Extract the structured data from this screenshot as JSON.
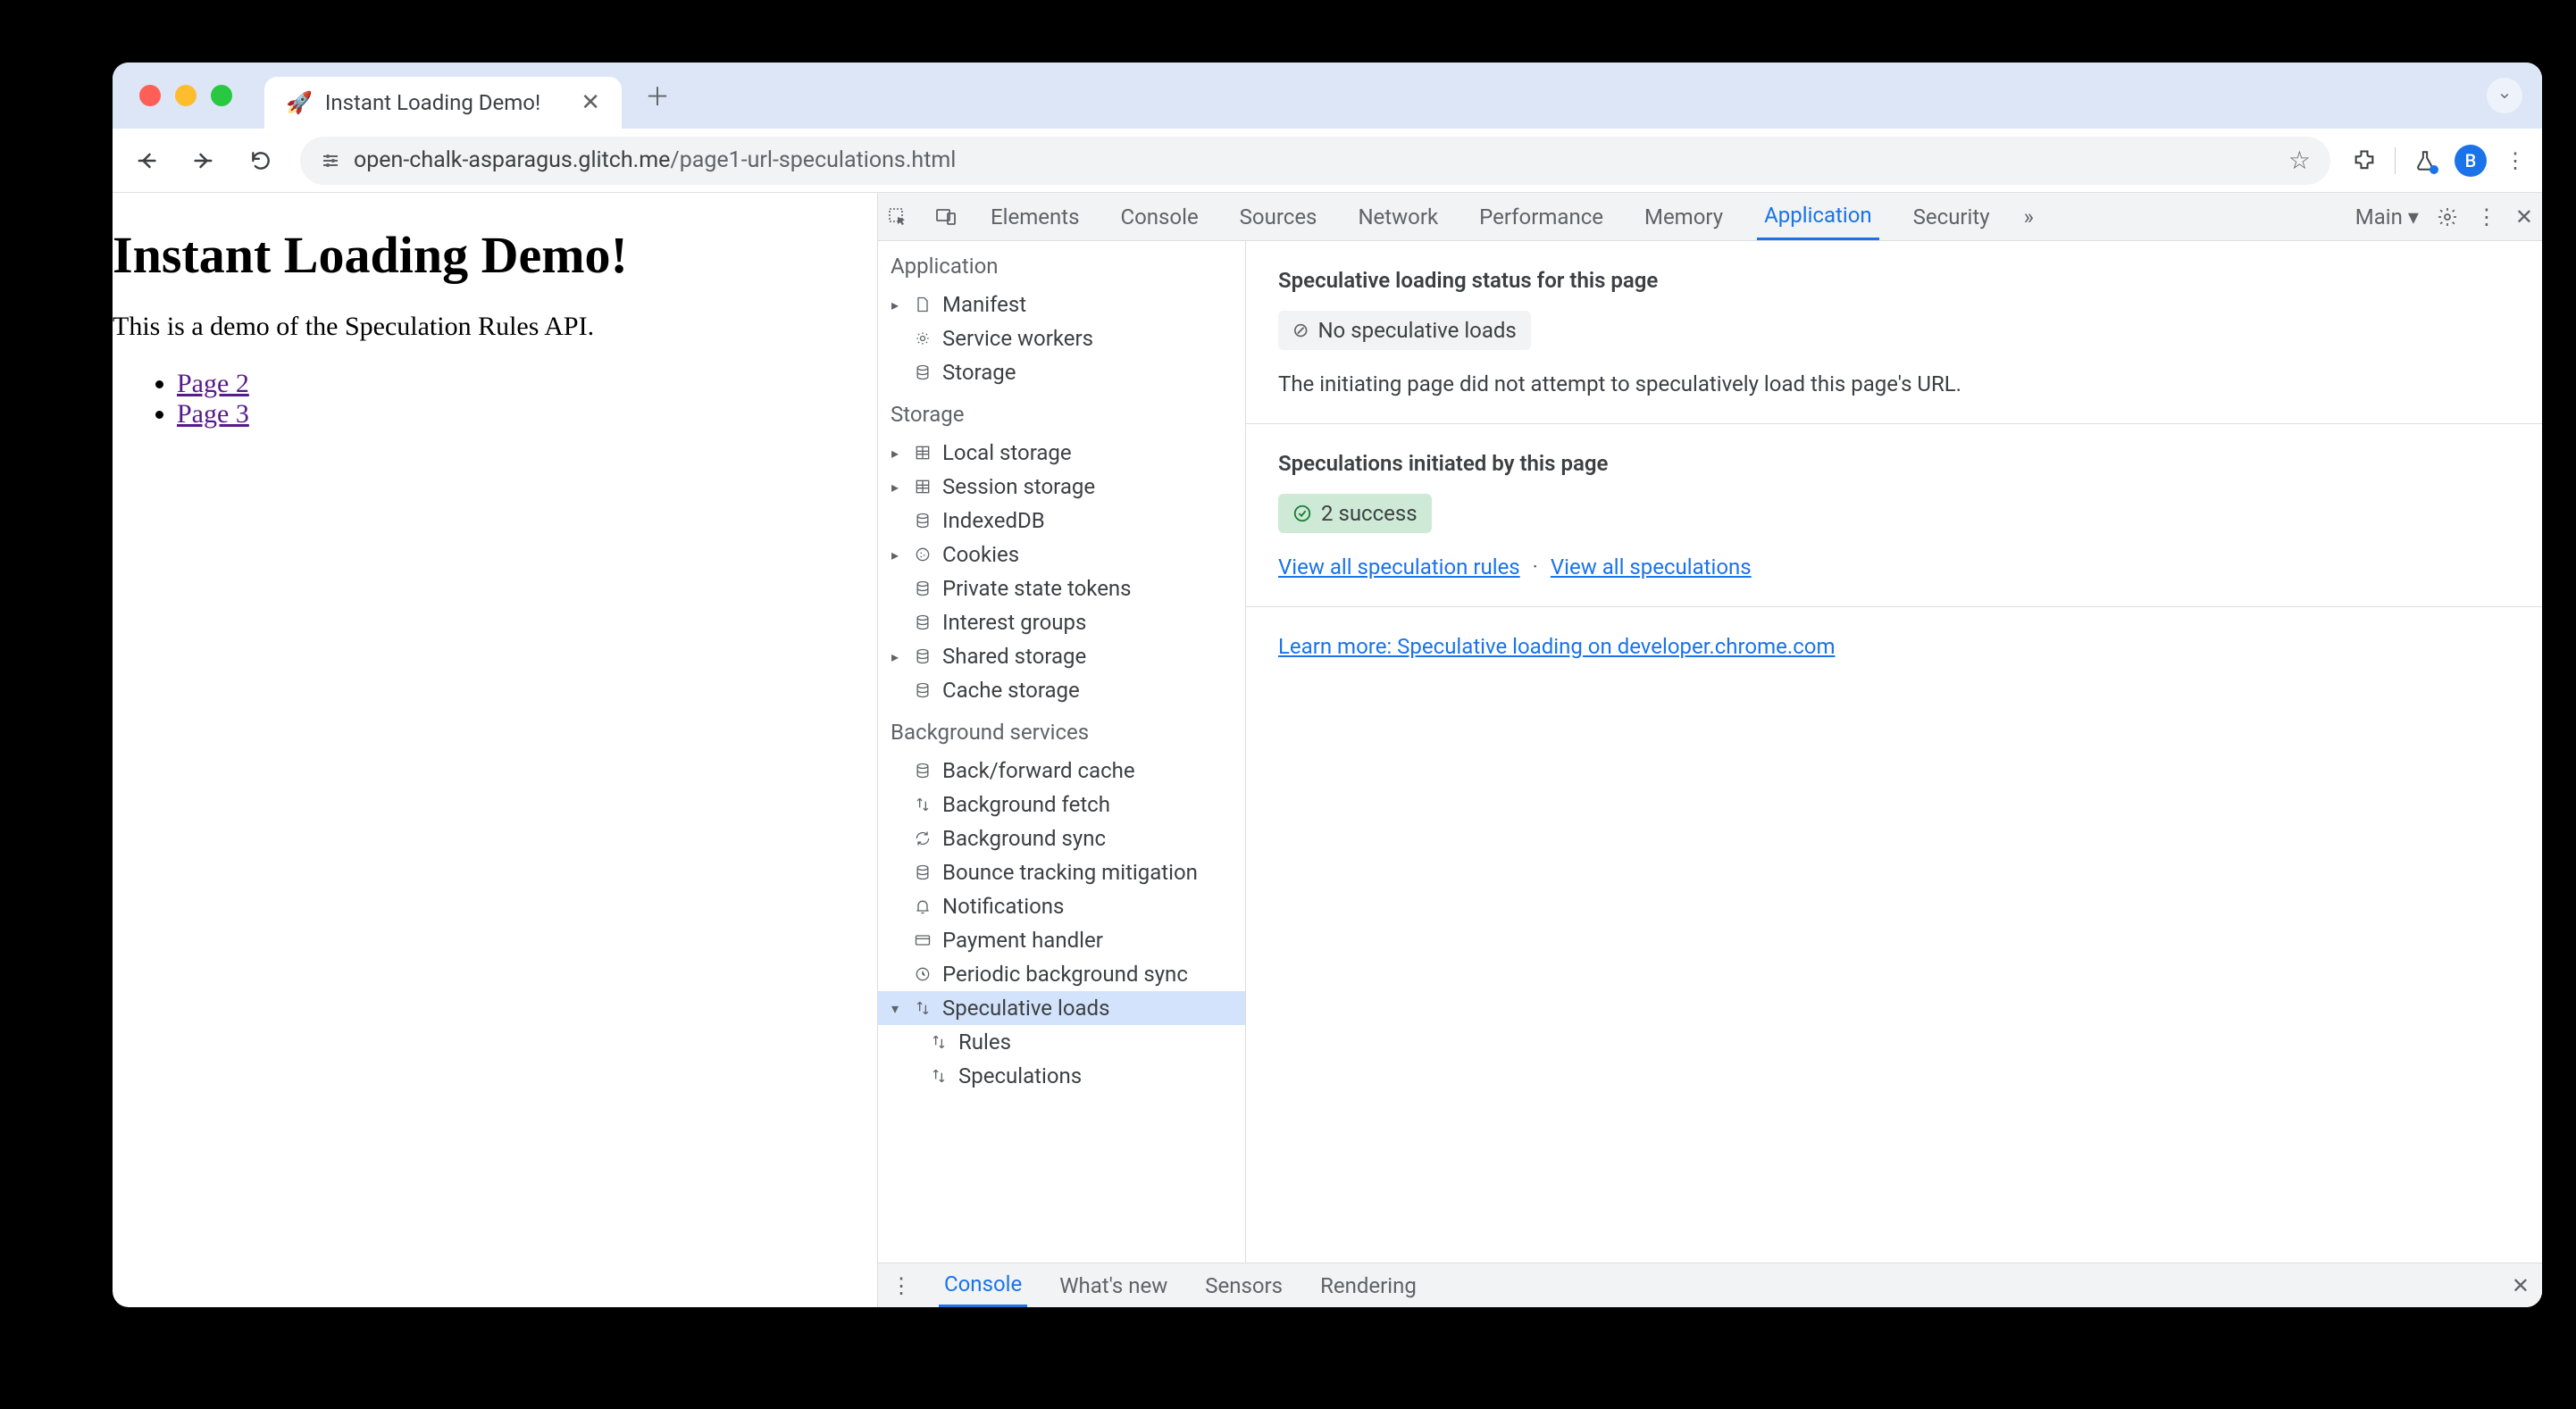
{
  "browser": {
    "tab_title": "Instant Loading Demo!",
    "favicon": "🚀",
    "url_host": "open-chalk-asparagus.glitch.me",
    "url_path": "/page1-url-speculations.html",
    "avatar_letter": "B"
  },
  "page": {
    "heading": "Instant Loading Demo!",
    "intro": "This is a demo of the Speculation Rules API.",
    "links": [
      "Page 2",
      "Page 3"
    ]
  },
  "devtools": {
    "tabs": [
      "Elements",
      "Console",
      "Sources",
      "Network",
      "Performance",
      "Memory",
      "Application",
      "Security"
    ],
    "active_tab": "Application",
    "frame_selector": "Main",
    "sidebar": {
      "application": {
        "label": "Application",
        "items": [
          {
            "label": "Manifest",
            "icon": "file",
            "expandable": true
          },
          {
            "label": "Service workers",
            "icon": "gear"
          },
          {
            "label": "Storage",
            "icon": "db"
          }
        ]
      },
      "storage": {
        "label": "Storage",
        "items": [
          {
            "label": "Local storage",
            "icon": "grid",
            "expandable": true
          },
          {
            "label": "Session storage",
            "icon": "grid",
            "expandable": true
          },
          {
            "label": "IndexedDB",
            "icon": "db"
          },
          {
            "label": "Cookies",
            "icon": "cookie",
            "expandable": true
          },
          {
            "label": "Private state tokens",
            "icon": "db"
          },
          {
            "label": "Interest groups",
            "icon": "db"
          },
          {
            "label": "Shared storage",
            "icon": "db",
            "expandable": true
          },
          {
            "label": "Cache storage",
            "icon": "db"
          }
        ]
      },
      "background": {
        "label": "Background services",
        "items": [
          {
            "label": "Back/forward cache",
            "icon": "db"
          },
          {
            "label": "Background fetch",
            "icon": "updown"
          },
          {
            "label": "Background sync",
            "icon": "sync"
          },
          {
            "label": "Bounce tracking mitigation",
            "icon": "db"
          },
          {
            "label": "Notifications",
            "icon": "bell"
          },
          {
            "label": "Payment handler",
            "icon": "card"
          },
          {
            "label": "Periodic background sync",
            "icon": "clock"
          },
          {
            "label": "Speculative loads",
            "icon": "updown",
            "expandable": true,
            "expanded": true,
            "selected": true,
            "children": [
              {
                "label": "Rules",
                "icon": "updown"
              },
              {
                "label": "Speculations",
                "icon": "updown"
              }
            ]
          }
        ]
      }
    },
    "panel": {
      "status_heading": "Speculative loading status for this page",
      "status_chip": "No speculative loads",
      "status_desc": "The initiating page did not attempt to speculatively load this page's URL.",
      "initiated_heading": "Speculations initiated by this page",
      "initiated_chip": "2 success",
      "link_rules": "View all speculation rules",
      "link_specs": "View all speculations",
      "learn_more": "Learn more: Speculative loading on developer.chrome.com"
    },
    "drawer": {
      "tabs": [
        "Console",
        "What's new",
        "Sensors",
        "Rendering"
      ],
      "active": "Console"
    }
  }
}
